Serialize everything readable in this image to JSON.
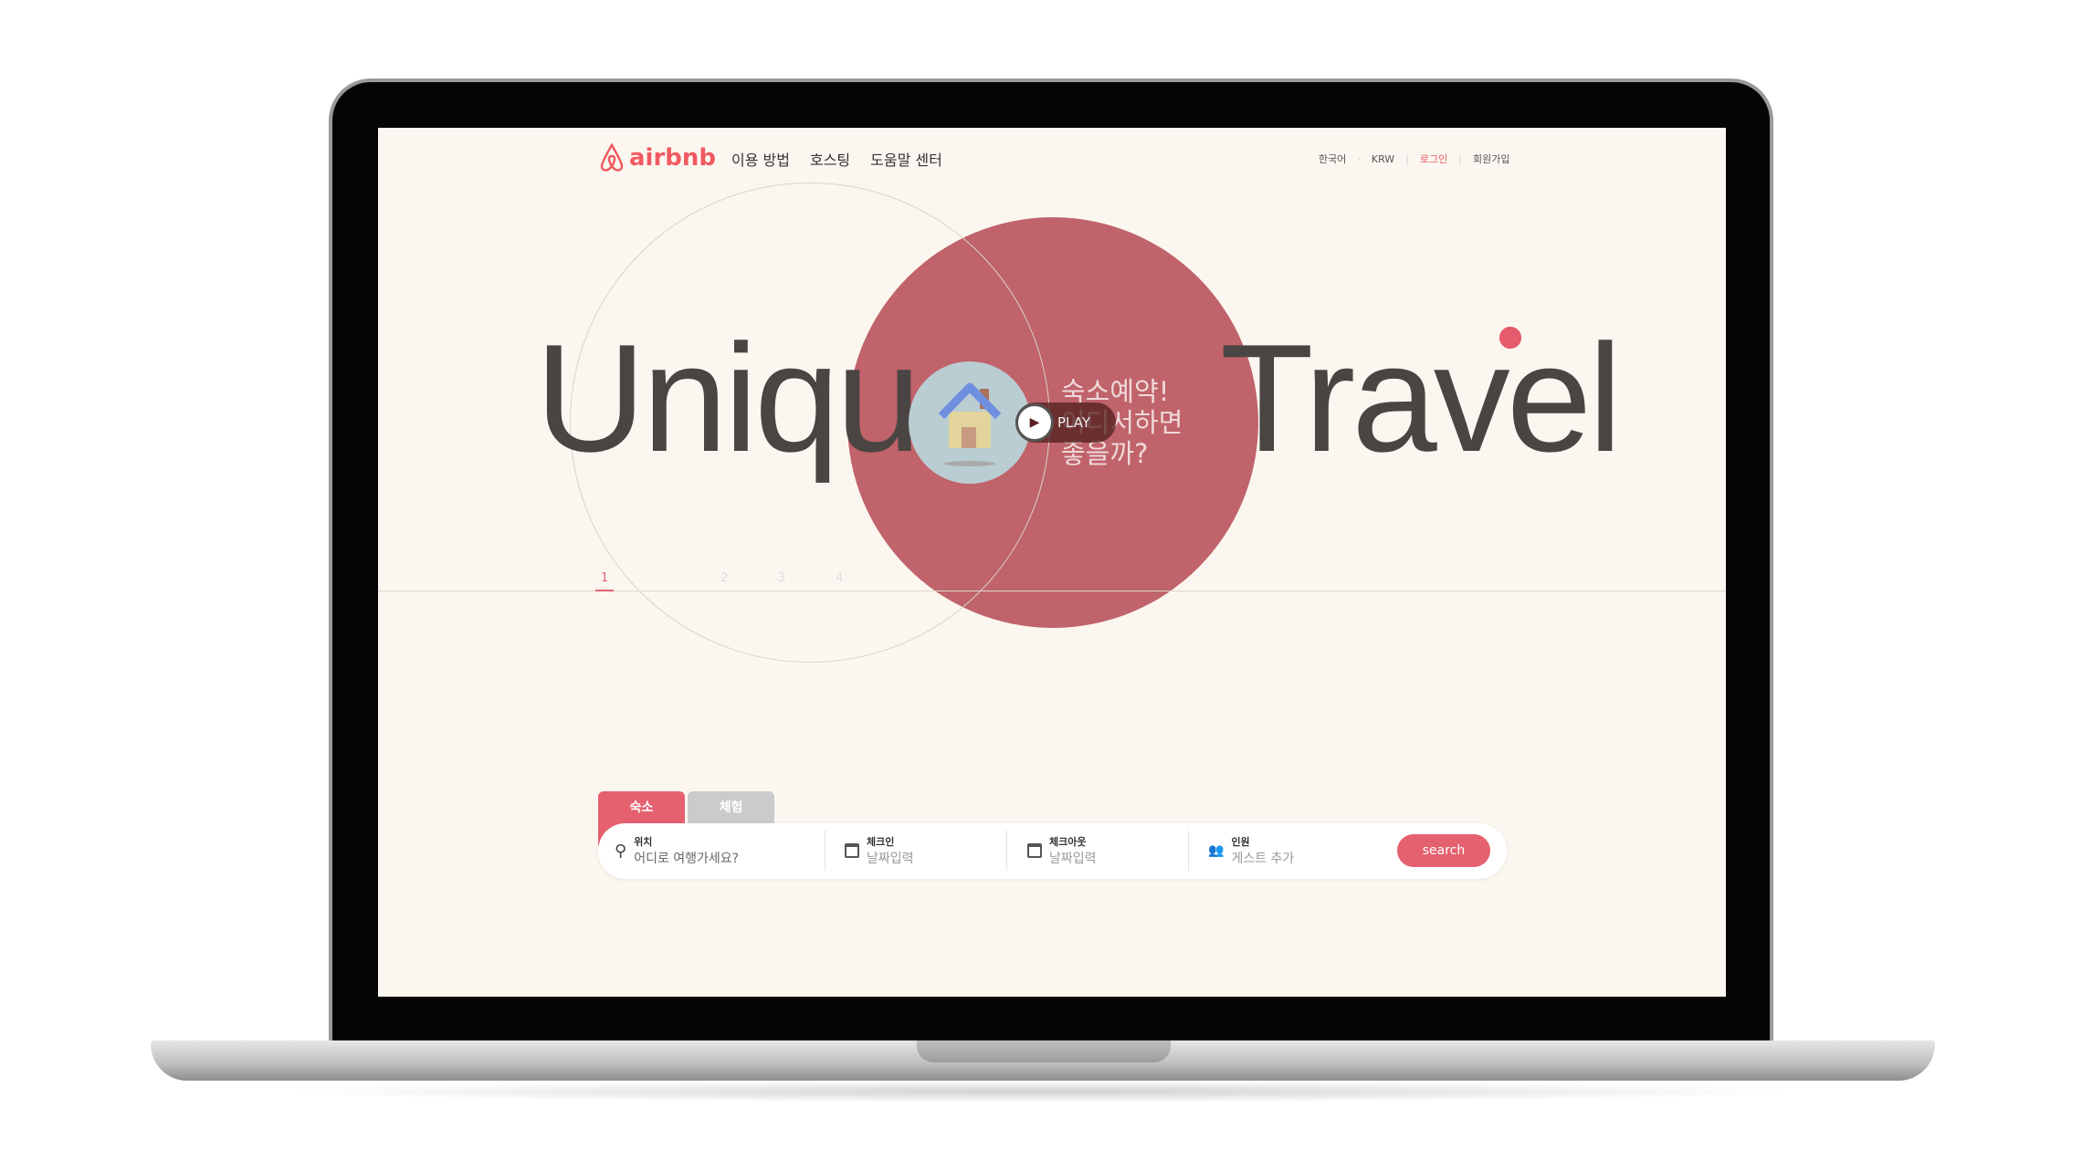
{
  "header": {
    "brand": "airbnb",
    "nav": [
      "이용 방법",
      "호스팅",
      "도움말 센터"
    ],
    "right": {
      "language": "한국어",
      "currency": "KRW",
      "login": "로그인",
      "signup": "회원가입"
    }
  },
  "hero": {
    "word_left": "Unique",
    "word_right": "Travel",
    "play_label": "PLAY",
    "tagline": [
      "숙소예약!",
      "어디서하면",
      "좋을까?"
    ],
    "slides": [
      "1",
      "2",
      "3",
      "4"
    ],
    "active_slide": 1
  },
  "search": {
    "tabs": [
      "숙소",
      "체험"
    ],
    "fields": [
      {
        "label": "위치",
        "placeholder": "어디로 여행가세요?"
      },
      {
        "label": "체크인",
        "placeholder": "날짜입력"
      },
      {
        "label": "체크아웃",
        "placeholder": "날짜입력"
      },
      {
        "label": "인원",
        "placeholder": "게스트 추가"
      }
    ],
    "button": "search"
  },
  "colors": {
    "brand": "#f05a61",
    "circle": "#c0636a",
    "button": "#e5616f"
  }
}
